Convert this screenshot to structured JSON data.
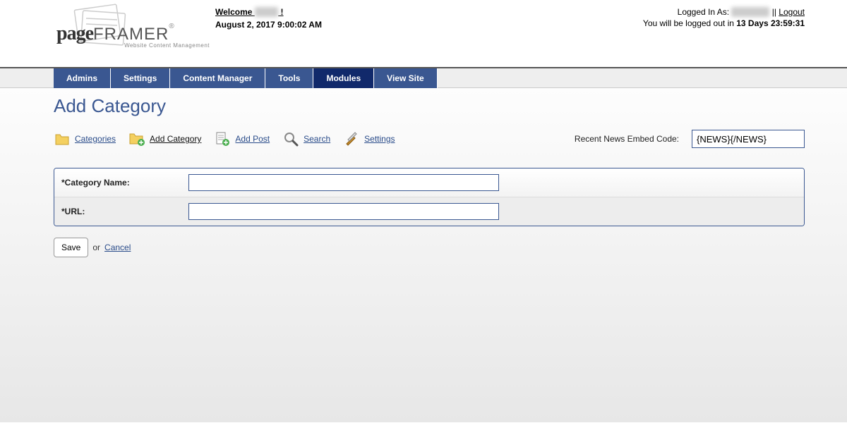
{
  "logo": {
    "page": "page",
    "framer": "FRAMER",
    "sub": "Website Content Management"
  },
  "header": {
    "welcome_prefix": "Welcome ",
    "welcome_name": "xxxxx",
    "welcome_suffix": " !",
    "date": "August 2, 2017 9:00:02 AM",
    "logged_in_prefix": "Logged In As: ",
    "logged_in_user": "xxxxxxxxx",
    "separator": " || ",
    "logout": "Logout",
    "autologout_prefix": "You will be logged out in ",
    "autologout_time": "13 Days 23:59:31"
  },
  "tabs": [
    "Admins",
    "Settings",
    "Content Manager",
    "Tools",
    "Modules",
    "View Site"
  ],
  "active_tab_index": 4,
  "page_title": "Add Category",
  "toolbar": {
    "categories": "Categories",
    "add_category": "Add Category",
    "add_post": "Add Post",
    "search": "Search",
    "settings": "Settings",
    "embed_label": "Recent News Embed Code:",
    "embed_value": "{NEWS}{/NEWS}"
  },
  "form": {
    "category_name_label": "*Category Name:",
    "category_name_value": "",
    "url_label": "*URL:",
    "url_value": ""
  },
  "actions": {
    "save": "Save",
    "or": "or",
    "cancel": "Cancel"
  }
}
